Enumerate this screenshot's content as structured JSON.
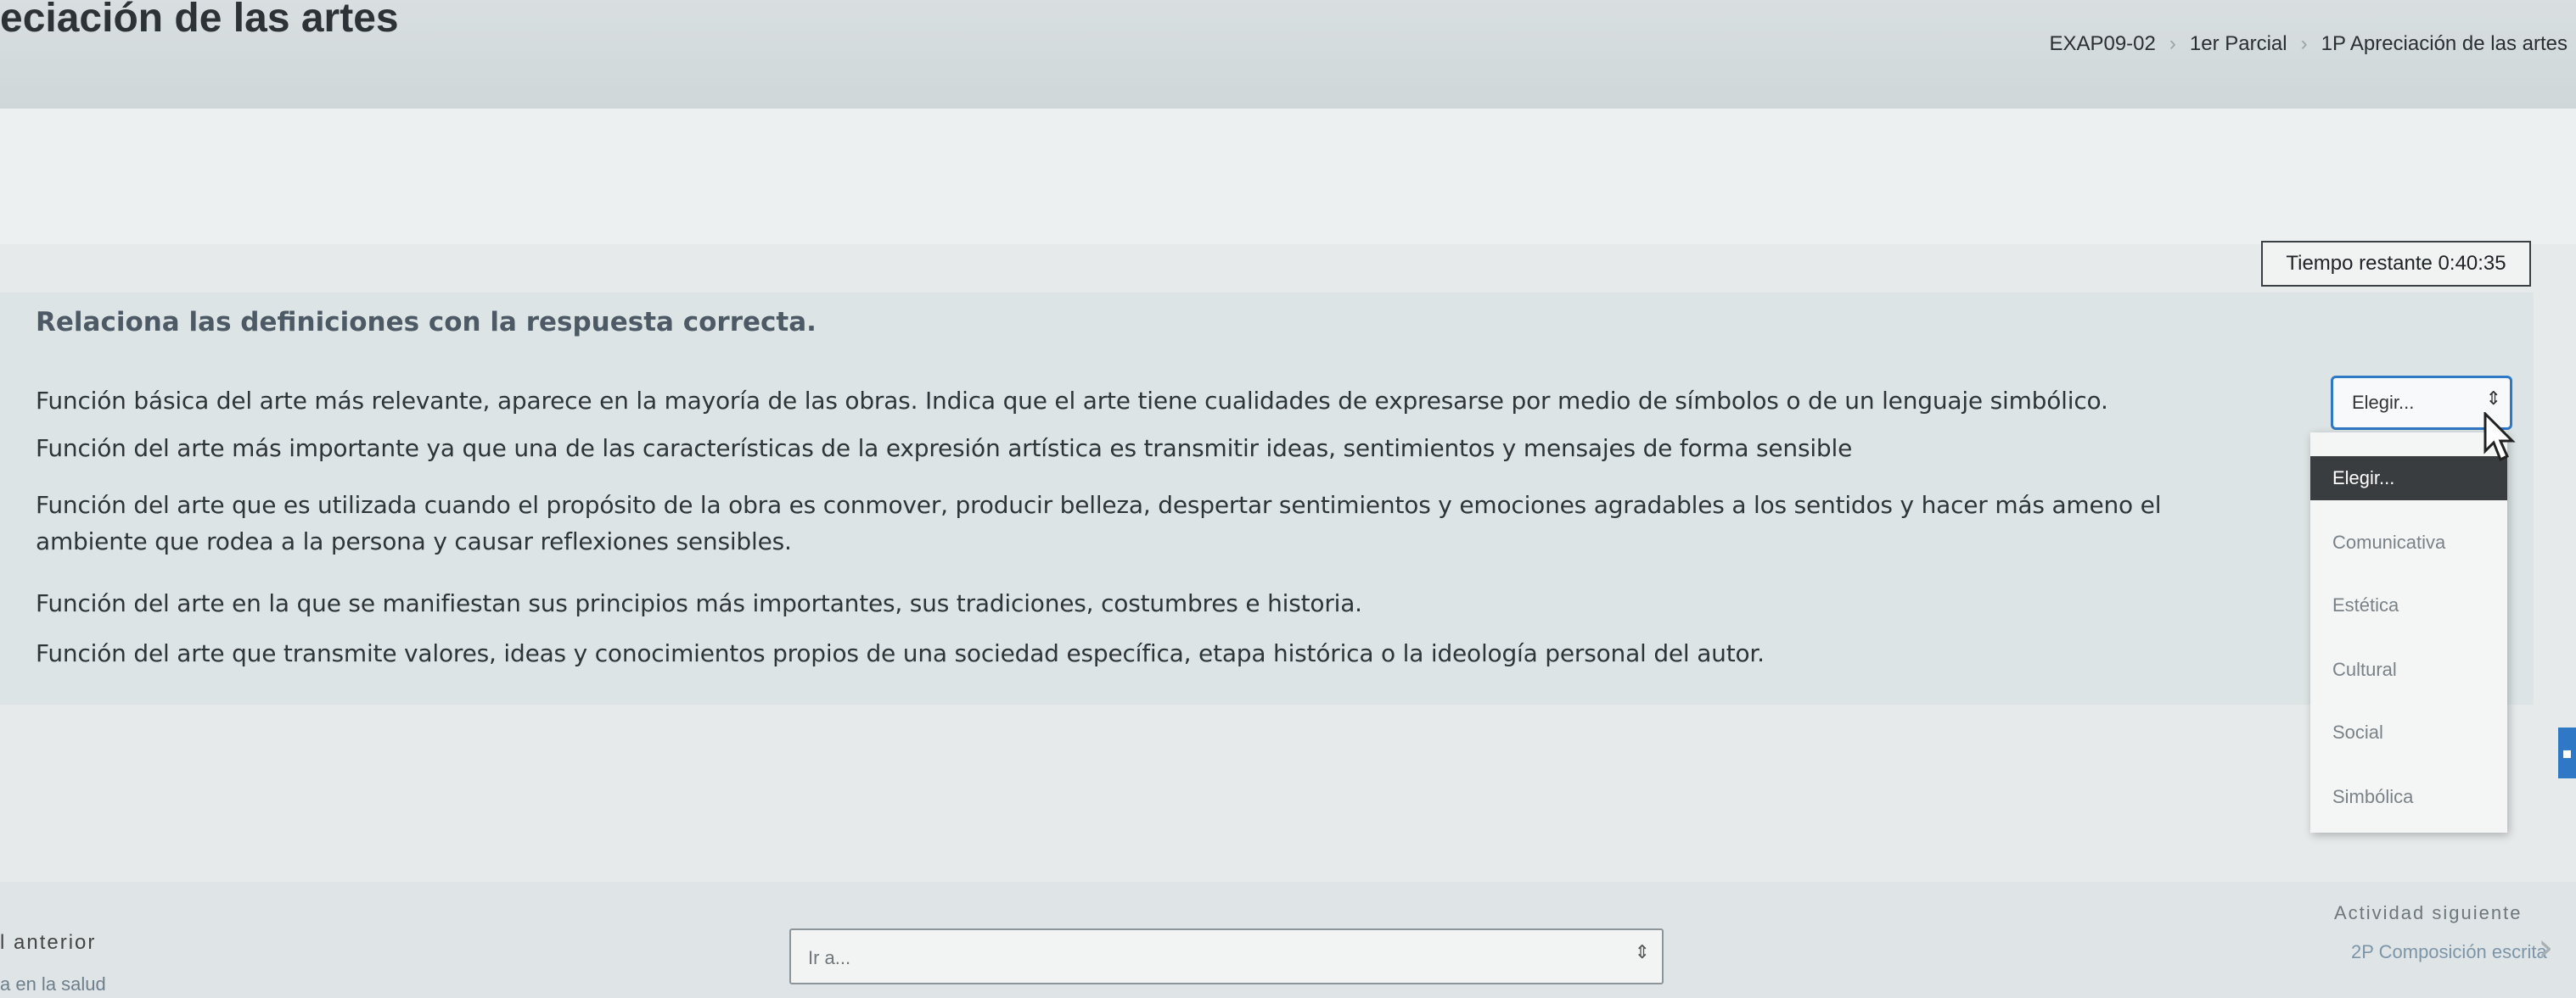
{
  "header": {
    "course_title": "eciación de las artes",
    "breadcrumbs": [
      "EXAP09-02",
      "1er Parcial",
      "1P Apreciación de las artes"
    ]
  },
  "timer": {
    "text": "Tiempo restante 0:40:35"
  },
  "question": {
    "instruction": "Relaciona las definiciones con la respuesta correcta.",
    "stems": [
      "Función básica del arte más relevante, aparece en la mayoría de las obras. Indica que el arte tiene cualidades de expresarse por medio de símbolos o de un lenguaje simbólico.",
      "Función del arte más importante ya que una de las características de la expresión artística es transmitir ideas, sentimientos y mensajes de forma sensible",
      "Función del arte que es utilizada cuando el propósito de la obra es conmover, producir belleza, despertar sentimientos y emociones agradables a los sentidos y hacer más ameno el",
      "ambiente que rodea a la persona y causar reflexiones sensibles.",
      "Función del arte en la que se manifiestan sus principios más importantes, sus tradiciones, costumbres e historia.",
      "Función del arte que transmite valores, ideas y conocimientos propios de una sociedad específica, etapa histórica o la ideología personal del autor."
    ],
    "select_value": "Elegir...",
    "options": [
      "Elegir...",
      "Comunicativa",
      "Estética",
      "Cultural",
      "Social",
      "Simbólica"
    ],
    "selected_option_index": 0
  },
  "navigation": {
    "prev_label": "l anterior",
    "prev_link": "a en la salud",
    "jump_placeholder": "Ir a...",
    "next_label": "Actividad siguiente",
    "next_link": "2P Composición escrita"
  },
  "icons": {
    "select_arrow": "up-down-arrow-icon",
    "cursor": "mouse-pointer-icon",
    "next": "chevron-right-icon"
  },
  "colors": {
    "accent": "#2f78c6",
    "selected_option_bg": "#3a3d40"
  }
}
